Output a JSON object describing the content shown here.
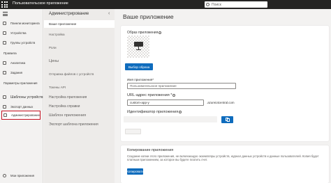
{
  "topbar": {
    "app_name": "Пользовательское приложение",
    "search_placeholder": "Поиск"
  },
  "leftnav": {
    "items_top": [
      {
        "label": "Панели мониторинга",
        "icon": "dashboard-icon"
      },
      {
        "label": "Устройства",
        "icon": "devices-icon"
      },
      {
        "label": "Группы устройств",
        "icon": "device-groups-icon"
      }
    ],
    "section_analytics": "Правила",
    "items_mid": [
      {
        "label": "Аналитика",
        "icon": "analytics-icon"
      },
      {
        "label": "Задания",
        "icon": "jobs-icon"
      }
    ],
    "section_settings": "Параметры приложения",
    "items_settings": [
      {
        "label": "Шаблоны устройств",
        "icon": "device-templates-icon"
      },
      {
        "label": "Экспорт данных",
        "icon": "data-export-icon"
      },
      {
        "label": "Администрирование",
        "icon": "administration-icon"
      }
    ],
    "bottom": "Мои приложения"
  },
  "subnav": {
    "title": "Администрирование",
    "items": [
      "Ваше приложение",
      "Настройка",
      "Роли",
      "Цены",
      "Отправка файлов с устройств",
      "Токены API",
      "Настройка приложения",
      "Настройка справки"
    ],
    "section": "Шаблон приложения",
    "section_item": "Экспорт шаблона приложения"
  },
  "main": {
    "title": "Ваше приложение",
    "image_label": "Образ приложения",
    "upload_button": "Выбор образа",
    "app_name_label": "Имя приложения*",
    "app_name_placeholder": "Пользовательское приложение",
    "url_label": "URL-адрес приложения *",
    "url_value": "custom-app-y",
    "url_suffix": ".azureiotcentral.com",
    "app_id_label": "Идентификатор приложения",
    "copy_section_title": "Копирование приложения",
    "copy_section_desc": "Создание копии этого приложения, не включающую экземпляры устройств, журнал данных устройств и данные пользователей. Копия будет платным приложением, за которое вы будете платить счет.",
    "copy_button": "Копировать"
  }
}
